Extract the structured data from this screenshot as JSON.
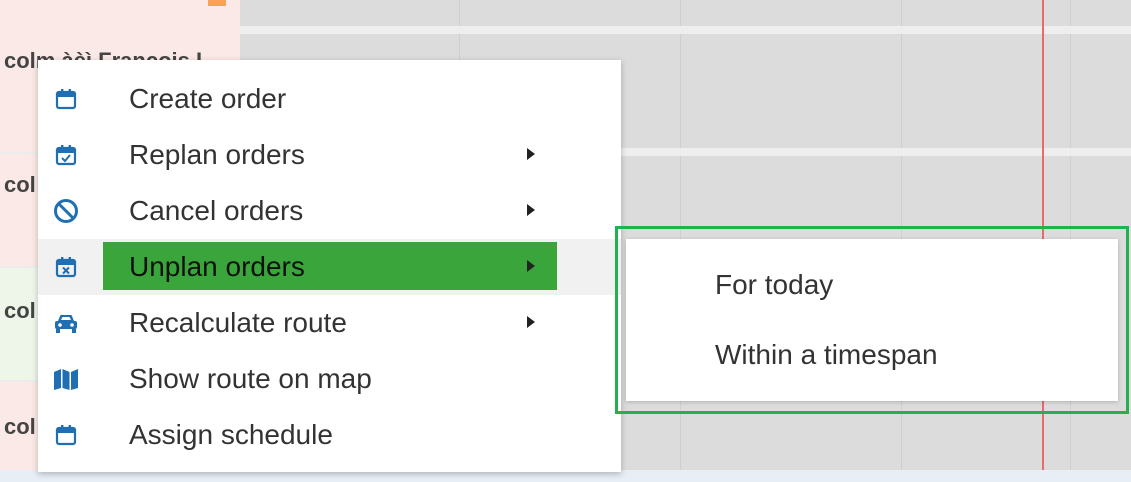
{
  "scheduler": {
    "rows": [
      {
        "label": "colm àèì François L"
      },
      {
        "label": "col"
      },
      {
        "label": "col"
      },
      {
        "label": "col"
      }
    ]
  },
  "colors": {
    "menu_highlight": "#3aa53a",
    "icon_blue": "#1f6fb2",
    "submenu_border": "#22b14c",
    "now_line": "#e86b6b"
  },
  "context_menu": {
    "items": [
      {
        "label": "Create order",
        "icon": "calendar-icon",
        "has_submenu": false
      },
      {
        "label": "Replan orders",
        "icon": "calendar-check-icon",
        "has_submenu": true
      },
      {
        "label": "Cancel orders",
        "icon": "ban-icon",
        "has_submenu": true
      },
      {
        "label": "Unplan orders",
        "icon": "calendar-x-icon",
        "has_submenu": true
      },
      {
        "label": "Recalculate route",
        "icon": "car-icon",
        "has_submenu": true
      },
      {
        "label": "Show route on map",
        "icon": "map-icon",
        "has_submenu": false
      },
      {
        "label": "Assign schedule",
        "icon": "calendar-icon",
        "has_submenu": false
      }
    ]
  },
  "submenu": {
    "items": [
      {
        "label": "For today"
      },
      {
        "label": "Within a timespan"
      }
    ]
  }
}
